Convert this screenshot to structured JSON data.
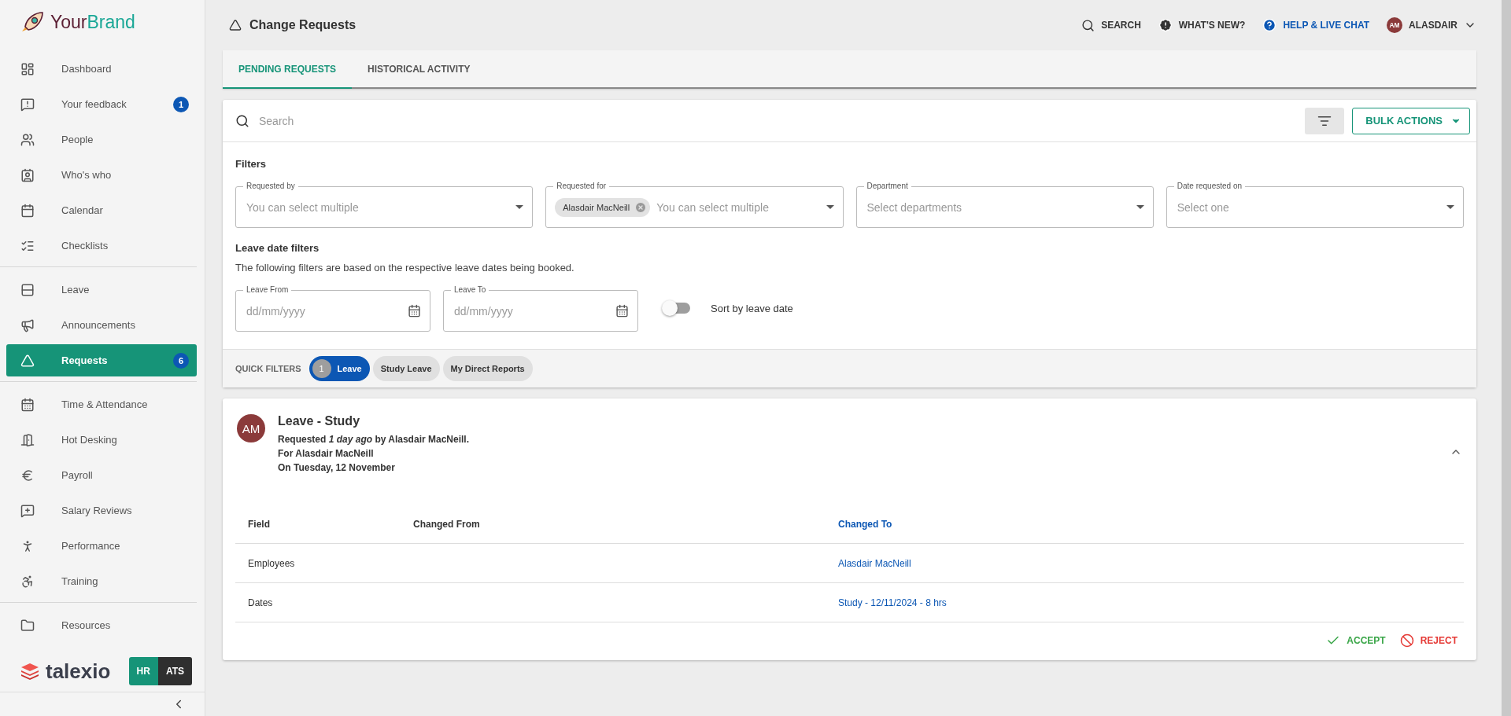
{
  "brand": {
    "first": "Your",
    "second": "Brand"
  },
  "sidebar": {
    "groups": [
      {
        "items": [
          {
            "label": "Dashboard",
            "selected": false
          },
          {
            "label": "Your feedback",
            "selected": false,
            "badge": "1"
          },
          {
            "label": "People",
            "selected": false
          },
          {
            "label": "Who's who",
            "selected": false
          },
          {
            "label": "Calendar",
            "selected": false
          },
          {
            "label": "Checklists",
            "selected": false
          }
        ]
      },
      {
        "items": [
          {
            "label": "Leave",
            "selected": false
          },
          {
            "label": "Announcements",
            "selected": false
          },
          {
            "label": "Requests",
            "selected": true,
            "badge": "6"
          }
        ]
      },
      {
        "items": [
          {
            "label": "Time & Attendance",
            "selected": false
          },
          {
            "label": "Hot Desking",
            "selected": false
          },
          {
            "label": "Payroll",
            "selected": false
          },
          {
            "label": "Salary Reviews",
            "selected": false
          },
          {
            "label": "Performance",
            "selected": false
          },
          {
            "label": "Training",
            "selected": false
          }
        ]
      },
      {
        "items": [
          {
            "label": "Resources",
            "selected": false
          }
        ]
      }
    ]
  },
  "product_logo": "talexio",
  "product_switch": [
    {
      "label": "HR",
      "selected": true
    },
    {
      "label": "ATS",
      "selected": false
    }
  ],
  "header": {
    "title": "Change Requests",
    "actions": [
      {
        "kind": "search",
        "label": "SEARCH"
      },
      {
        "kind": "news",
        "label": "WHAT'S NEW?"
      },
      {
        "kind": "help",
        "label": "HELP & LIVE CHAT"
      }
    ],
    "user": {
      "initials": "AM",
      "name": "ALASDAIR"
    }
  },
  "tabs": [
    {
      "label": "PENDING REQUESTS",
      "selected": true
    },
    {
      "label": "HISTORICAL ACTIVITY",
      "selected": false
    }
  ],
  "search": {
    "placeholder": "Search"
  },
  "bulk_actions": "BULK ACTIONS",
  "filters": {
    "title": "Filters",
    "fields": [
      {
        "label": "Requested by",
        "placeholder": "You can select multiple"
      },
      {
        "label": "Requested for",
        "placeholder": "You can select multiple",
        "chips": [
          "Alasdair MacNeill"
        ]
      },
      {
        "label": "Department",
        "placeholder": "Select departments"
      },
      {
        "label": "Date requested on",
        "placeholder": "Select one"
      }
    ]
  },
  "leave_date_filters": {
    "title": "Leave date filters",
    "description": "The following filters are based on the respective leave dates being booked.",
    "fields": [
      {
        "label": "Leave From",
        "placeholder": "dd/mm/yyyy"
      },
      {
        "label": "Leave To",
        "placeholder": "dd/mm/yyyy"
      }
    ],
    "sort_toggle": {
      "label": "Sort by leave date",
      "on": false
    }
  },
  "quick_filters": {
    "label": "QUICK FILTERS",
    "chips": [
      {
        "label": "Leave",
        "count": "1",
        "selected": true
      },
      {
        "label": "Study Leave",
        "selected": false
      },
      {
        "label": "My Direct Reports",
        "selected": false
      }
    ]
  },
  "request": {
    "initials": "AM",
    "title": "Leave - Study",
    "lines": [
      "Requested *1 day ago* by Alasdair MacNeill.",
      "For Alasdair MacNeill",
      "On Tuesday, 12 November"
    ],
    "expanded": true,
    "columns": [
      "Field",
      "Changed From",
      "Changed To"
    ],
    "rows": [
      [
        "Employees",
        "",
        "Alasdair MacNeill"
      ],
      [
        "Dates",
        "",
        "Study - 12/11/2024 - 8 hrs"
      ]
    ],
    "actions": [
      {
        "kind": "accept",
        "label": "ACCEPT"
      },
      {
        "kind": "reject",
        "label": "REJECT"
      }
    ]
  }
}
